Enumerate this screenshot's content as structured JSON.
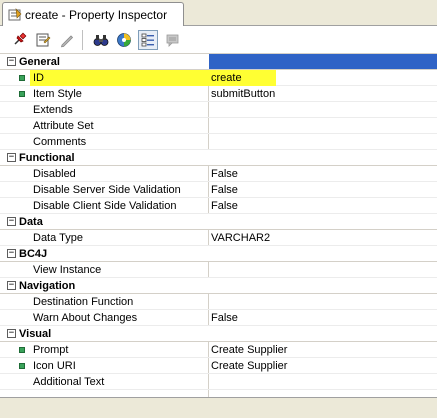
{
  "window": {
    "tab_title": "create - Property Inspector"
  },
  "toolbar": {
    "icons": [
      "pin-icon",
      "edit-properties-icon",
      "pencil-icon",
      "binoculars-icon",
      "palette-icon",
      "categories-icon",
      "comments-icon"
    ],
    "active": "categories-icon"
  },
  "colors": {
    "selected_category_bar": "#2f63c6",
    "highlight": "#ffff33",
    "bullet": "#3aa35a"
  },
  "categories": [
    {
      "name": "General",
      "expanded": true,
      "selected": true,
      "props": [
        {
          "name": "ID",
          "value": "create",
          "required": true,
          "highlighted": true
        },
        {
          "name": "Item Style",
          "value": "submitButton",
          "required": true
        },
        {
          "name": "Extends",
          "value": ""
        },
        {
          "name": "Attribute Set",
          "value": ""
        },
        {
          "name": "Comments",
          "value": ""
        }
      ]
    },
    {
      "name": "Functional",
      "expanded": true,
      "props": [
        {
          "name": "Disabled",
          "value": "False"
        },
        {
          "name": "Disable Server Side Validation",
          "value": "False"
        },
        {
          "name": "Disable Client Side Validation",
          "value": "False"
        }
      ]
    },
    {
      "name": "Data",
      "expanded": true,
      "props": [
        {
          "name": "Data Type",
          "value": "VARCHAR2"
        }
      ]
    },
    {
      "name": "BC4J",
      "expanded": true,
      "props": [
        {
          "name": "View Instance",
          "value": ""
        }
      ]
    },
    {
      "name": "Navigation",
      "expanded": true,
      "props": [
        {
          "name": "Destination Function",
          "value": ""
        },
        {
          "name": "Warn About Changes",
          "value": "False"
        }
      ]
    },
    {
      "name": "Visual",
      "expanded": true,
      "props": [
        {
          "name": "Prompt",
          "value": "Create Supplier",
          "required": true
        },
        {
          "name": "Icon URI",
          "value": "Create Supplier",
          "required": true
        },
        {
          "name": "Additional Text",
          "value": ""
        }
      ]
    }
  ]
}
